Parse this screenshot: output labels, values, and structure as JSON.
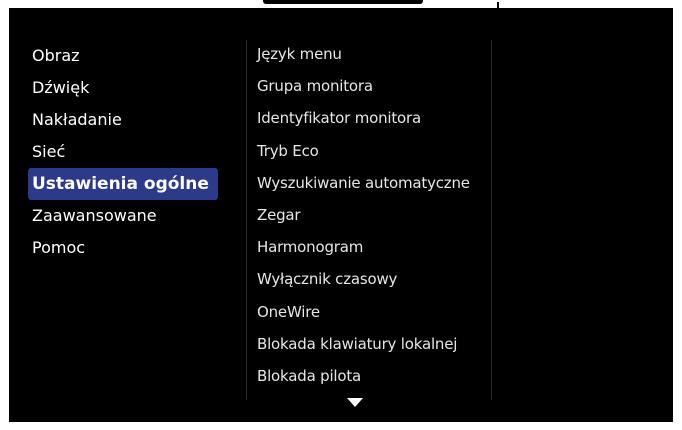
{
  "main_menu": {
    "items": [
      {
        "label": "Obraz"
      },
      {
        "label": "Dźwięk"
      },
      {
        "label": "Nakładanie"
      },
      {
        "label": "Sieć"
      },
      {
        "label": "Ustawienia ogólne",
        "selected": true
      },
      {
        "label": "Zaawansowane"
      },
      {
        "label": "Pomoc"
      }
    ]
  },
  "submenu": {
    "items": [
      {
        "label": "Język menu"
      },
      {
        "label": "Grupa monitora"
      },
      {
        "label": "Identyfikator monitora"
      },
      {
        "label": "Tryb Eco"
      },
      {
        "label": "Wyszukiwanie automatyczne"
      },
      {
        "label": "Zegar"
      },
      {
        "label": "Harmonogram"
      },
      {
        "label": "Wyłącznik czasowy"
      },
      {
        "label": "OneWire"
      },
      {
        "label": "Blokada klawiatury lokalnej"
      },
      {
        "label": "Blokada pilota"
      }
    ],
    "more_below_icon": "chevron-down-icon"
  },
  "colors": {
    "background": "#000000",
    "highlight": "#2b3a8a",
    "text": "#ffffff"
  }
}
